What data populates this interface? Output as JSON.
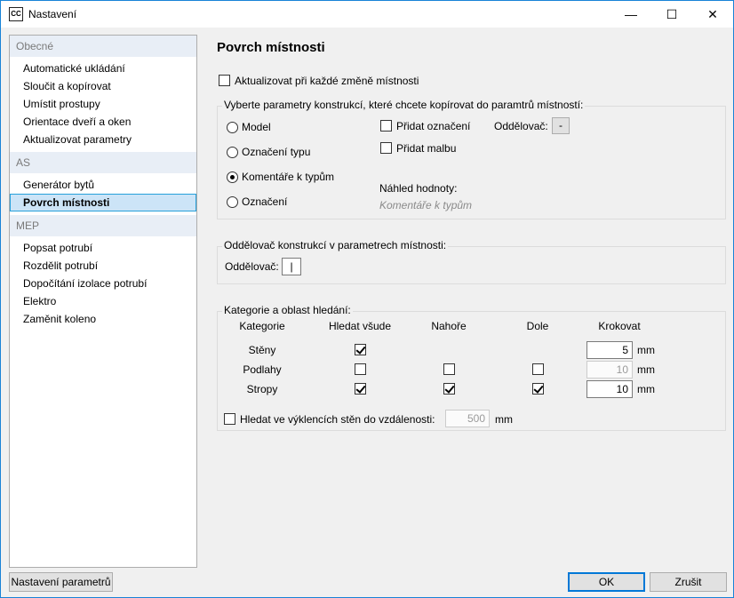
{
  "window": {
    "title": "Nastavení",
    "app_icon": "CC",
    "controls": {
      "minimize": "—",
      "maximize": "☐",
      "close": "✕"
    }
  },
  "sidebar": {
    "groups": [
      {
        "label": "Obecné",
        "items": [
          "Automatické ukládání",
          "Sloučit a kopírovat",
          "Umístit prostupy",
          "Orientace dveří a oken",
          "Aktualizovat parametry"
        ]
      },
      {
        "label": "AS",
        "items": [
          "Generátor bytů",
          "Povrch místnosti"
        ]
      },
      {
        "label": "MEP",
        "items": [
          "Popsat potrubí",
          "Rozdělit potrubí",
          "Dopočítání izolace potrubí",
          "Elektro",
          "Zaměnit koleno"
        ]
      }
    ],
    "selected": "Povrch místnosti"
  },
  "main": {
    "title": "Povrch místnosti",
    "update_on_change": {
      "label": "Aktualizovat při každé změně místnosti",
      "checked": false
    },
    "copy_group": {
      "title": "Vyberte parametry konstrukcí, které chcete kopírovat do paramtrů místností:",
      "radios": [
        {
          "label": "Model",
          "selected": false
        },
        {
          "label": "Označení typu",
          "selected": false
        },
        {
          "label": "Komentáře k typům",
          "selected": true
        },
        {
          "label": "Označení",
          "selected": false
        }
      ],
      "add_mark": {
        "label": "Přidat označení",
        "checked": false
      },
      "add_paint": {
        "label": "Přidat malbu",
        "checked": false
      },
      "separator_label": "Oddělovač:",
      "separator_value": "-",
      "preview_label": "Náhled hodnoty:",
      "preview_value": "Komentáře k typům"
    },
    "sep_group": {
      "title": "Oddělovač konstrukcí v parametrech místnosti:",
      "separator_label": "Oddělovač:",
      "separator_value": "|"
    },
    "search_group": {
      "title": "Kategorie a oblast hledání:",
      "headers": [
        "Kategorie",
        "Hledat všude",
        "Nahoře",
        "Dole",
        "Krokovat"
      ],
      "rows": [
        {
          "name": "Stěny",
          "everywhere": true,
          "top": null,
          "bottom": null,
          "step": "5",
          "step_enabled": true,
          "unit": "mm"
        },
        {
          "name": "Podlahy",
          "everywhere": false,
          "top": false,
          "bottom": false,
          "step": "10",
          "step_enabled": false,
          "unit": "mm"
        },
        {
          "name": "Stropy",
          "everywhere": true,
          "top": true,
          "bottom": true,
          "step": "10",
          "step_enabled": true,
          "unit": "mm"
        }
      ],
      "niche": {
        "label": "Hledat ve výklencích stěn do vzdálenosti:",
        "checked": false,
        "value": "500",
        "unit": "mm"
      }
    }
  },
  "footer": {
    "params_button": "Nastavení parametrů",
    "ok_button": "OK",
    "cancel_button": "Zrušit"
  }
}
